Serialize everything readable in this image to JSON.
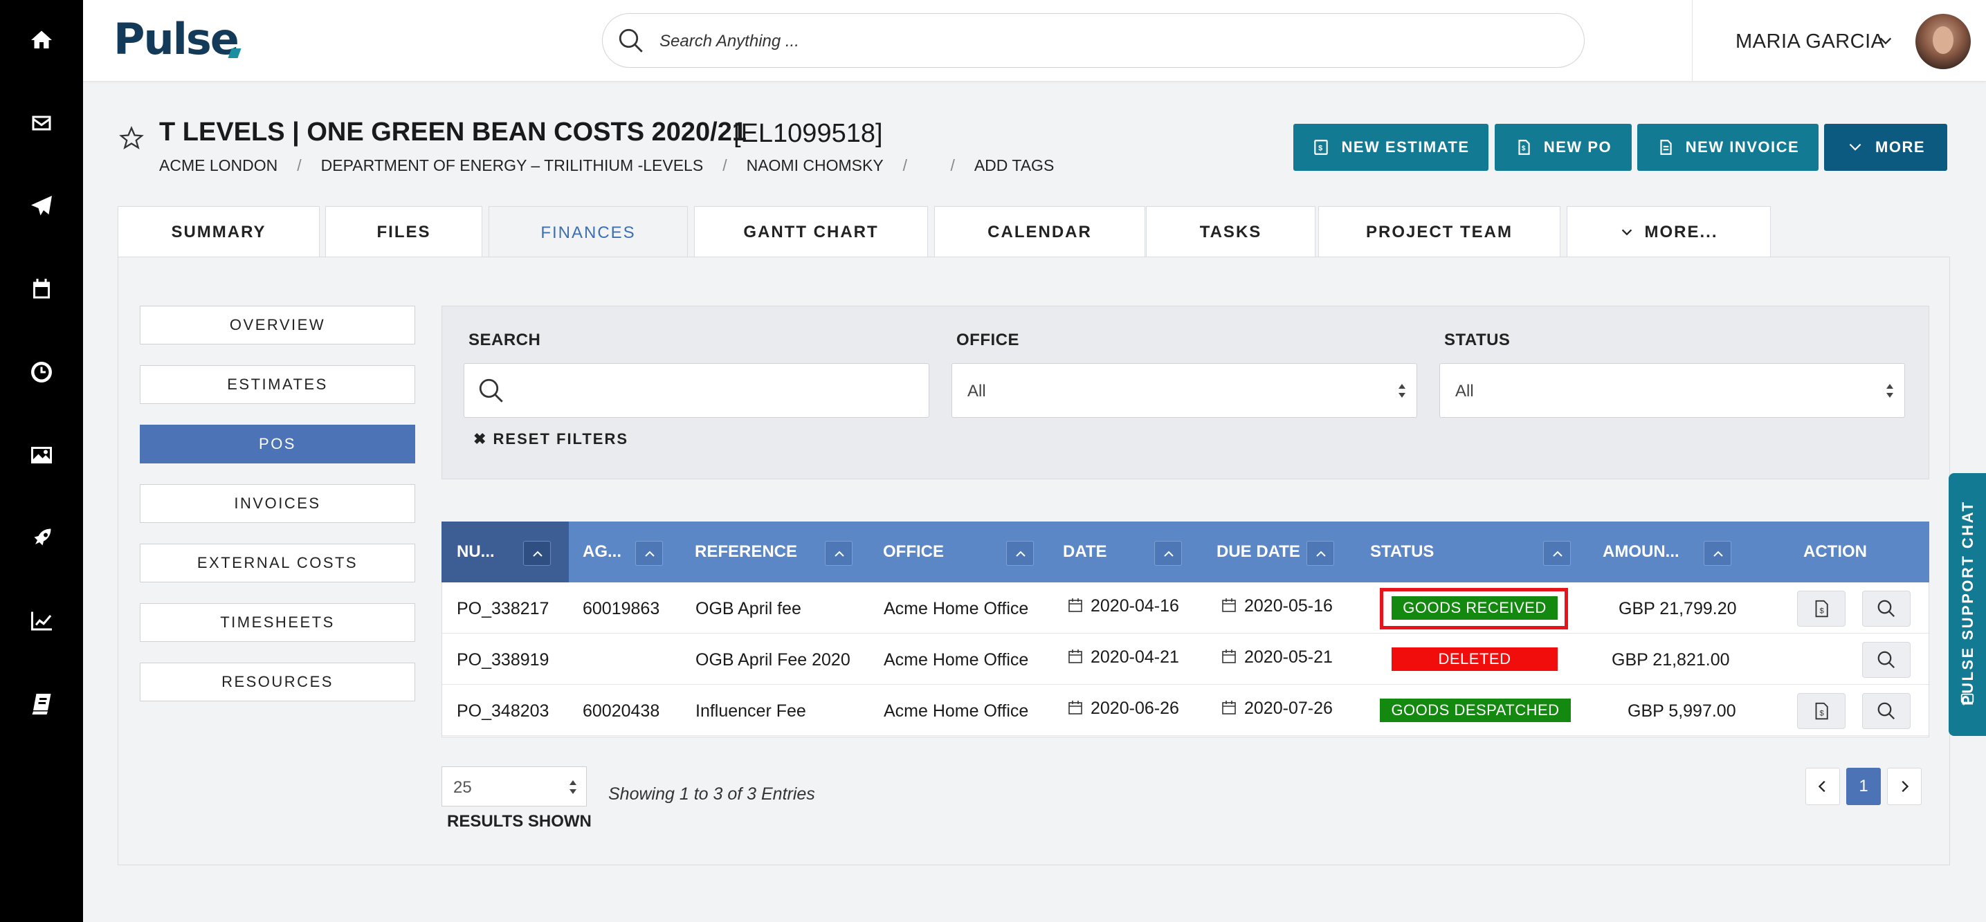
{
  "header": {
    "logo": "Pulse",
    "search_placeholder": "Search Anything ...",
    "user_name": "MARIA GARCIA"
  },
  "project": {
    "title": "T LEVELS | ONE GREEN BEAN COSTS 2020/21",
    "code": "[EL1099518]",
    "breadcrumbs": [
      "ACME LONDON",
      "DEPARTMENT OF ENERGY – TRILITHIUM -LEVELS",
      "NAOMI CHOMSKY",
      " ",
      "ADD TAGS"
    ]
  },
  "actions": {
    "new_estimate": "NEW ESTIMATE",
    "new_po": "NEW PO",
    "new_invoice": "NEW INVOICE",
    "more": "MORE"
  },
  "tabs": [
    "SUMMARY",
    "FILES",
    "FINANCES",
    "GANTT CHART",
    "CALENDAR",
    "TASKS",
    "PROJECT TEAM",
    "MORE..."
  ],
  "active_tab": "FINANCES",
  "side_nav": [
    "OVERVIEW",
    "ESTIMATES",
    "POS",
    "INVOICES",
    "EXTERNAL COSTS",
    "TIMESHEETS",
    "RESOURCES"
  ],
  "active_side": "POS",
  "filters": {
    "search_label": "SEARCH",
    "office_label": "OFFICE",
    "office_value": "All",
    "status_label": "STATUS",
    "status_value": "All",
    "reset_label": "RESET FILTERS"
  },
  "table": {
    "columns": [
      "NU...",
      "AG...",
      "REFERENCE",
      "OFFICE",
      "DATE",
      "DUE DATE",
      "STATUS",
      "AMOUN...",
      "ACTION"
    ],
    "rows": [
      {
        "number": "PO_338217",
        "agency": "60019863",
        "reference": "OGB April fee",
        "office": "Acme Home Office",
        "date": "2020-04-16",
        "due_date": "2020-05-16",
        "status": "GOODS RECEIVED",
        "amount": "GBP 21,799.20"
      },
      {
        "number": "PO_338919",
        "agency": "",
        "reference": "OGB April Fee 2020",
        "office": "Acme Home Office",
        "date": "2020-04-21",
        "due_date": "2020-05-21",
        "status": "DELETED",
        "amount": "GBP 21,821.00"
      },
      {
        "number": "PO_348203",
        "agency": "60020438",
        "reference": "Influencer Fee",
        "office": "Acme Home Office",
        "date": "2020-06-26",
        "due_date": "2020-07-26",
        "status": "GOODS DESPATCHED",
        "amount": "GBP 5,997.00"
      }
    ]
  },
  "footer": {
    "page_size": "25",
    "results_label": "RESULTS SHOWN",
    "showing": "Showing 1 to 3 of 3 Entries",
    "current_page": "1"
  },
  "support_chat": "PULSE SUPPORT CHAT",
  "colors": {
    "accent": "#127a92",
    "primary_blue": "#4b73b6",
    "status_green": "#14890f",
    "status_red": "#f20d0d",
    "highlight": "#e8141c"
  }
}
